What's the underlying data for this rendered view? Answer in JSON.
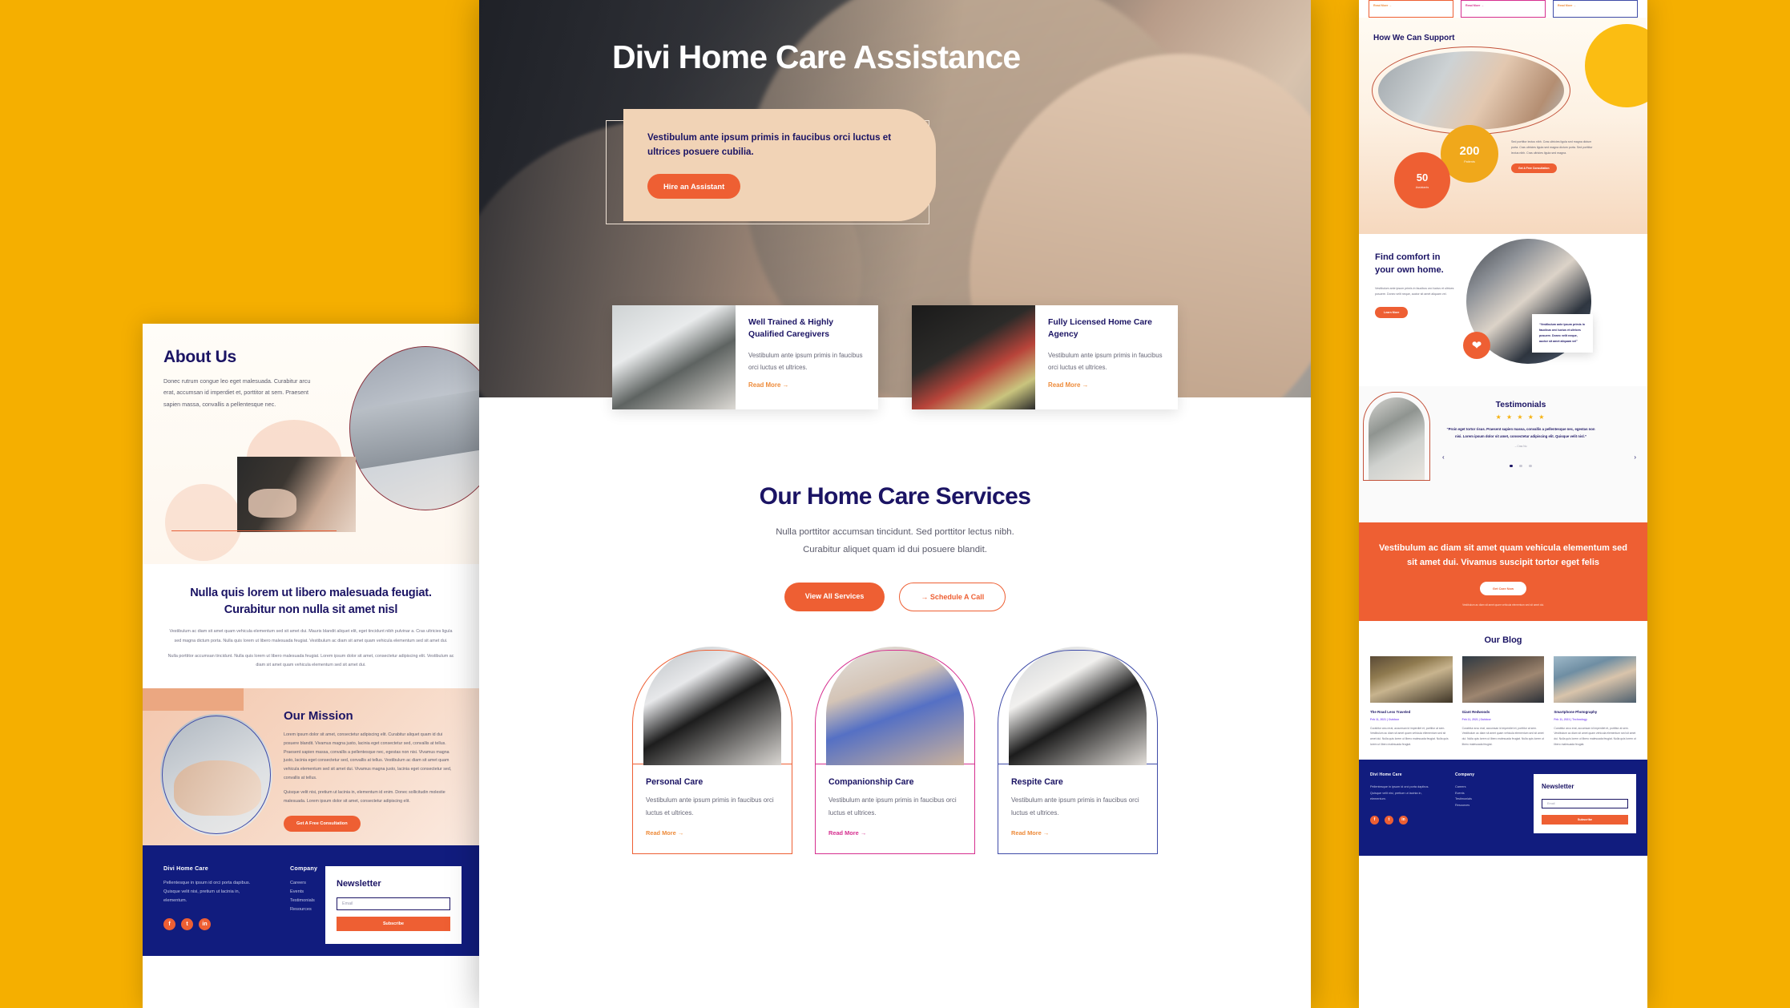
{
  "brand": {
    "accent": "#EE5F33",
    "navy": "#1B1464",
    "yellow": "#F5AF00",
    "footer_bg": "#111C7E"
  },
  "hero": {
    "title": "Divi Home Care Assistance",
    "card_text": "Vestibulum ante ipsum primis in faucibus orci luctus et ultrices posuere cubilia.",
    "cta": "Hire an Assistant"
  },
  "features": [
    {
      "title": "Well Trained & Highly Qualified Caregivers",
      "text": "Vestibulum ante ipsum primis in faucibus orci luctus et ultrices.",
      "link": "Read More  →"
    },
    {
      "title": "Fully Licensed Home Care Agency",
      "text": "Vestibulum ante ipsum primis in faucibus orci luctus et ultrices.",
      "link": "Read More  →"
    }
  ],
  "services": {
    "heading": "Our Home Care Services",
    "sub_line1": "Nulla porttitor accumsan tincidunt. Sed porttitor lectus nibh.",
    "sub_line2": "Curabitur aliquet quam id dui posuere blandit.",
    "btn_primary": "View All Services",
    "btn_secondary": "→  Schedule A Call",
    "cards": [
      {
        "title": "Personal Care",
        "text": "Vestibulum ante ipsum primis in faucibus orci luctus et ultrices.",
        "link": "Read More  →",
        "color": "#EE5F33"
      },
      {
        "title": "Companionship Care",
        "text": "Vestibulum ante ipsum primis in faucibus orci luctus et ultrices.",
        "link": "Read More  →",
        "color": "#D62F8F"
      },
      {
        "title": "Respite Care",
        "text": "Vestibulum ante ipsum primis in faucibus orci luctus et ultrices.",
        "link": "Read More  →",
        "color": "#3E4BA8"
      }
    ]
  },
  "left_page": {
    "about": {
      "heading": "About Us",
      "text": "Donec rutrum congue leo eget malesuada. Curabitur arcu erat, accumsan id imperdiet et, porttitor at sem. Praesent sapien massa, convallis a pellentesque nec."
    },
    "nulla": {
      "heading": "Nulla quis lorem ut libero malesuada feugiat. Curabitur non nulla sit amet nisl",
      "p1": "Vestibulum ac diam sit amet quam vehicula elementum sed sit amet dui. Mauris blandit aliquet elit, eget tincidunt nibh pulvinar a. Cras ultricies ligula sed magna dictum porta. Nulla quis lorem ut libero malesuada feugiat. Vestibulum ac diam sit amet quam vehicula elementum sed sit amet dui.",
      "p2": "Nulla porttitor accumsan tincidunt. Nulla quis lorem ut libero malesuada feugiat. Lorem ipsum dolor sit amet, consectetur adipiscing elit. Vestibulum ac diam sit amet quam vehicula elementum sed sit amet dui."
    },
    "mission": {
      "heading": "Our Mission",
      "p1": "Lorem ipsum dolor sit amet, consectetur adipiscing elit. Curabitur aliquet quam id dui posuere blandit. Vivamus magna justo, lacinia eget consectetur sed, convallis at tellus. Praesent sapien massa, convallis a pellentesque nec, egestas non nisi. Vivamus magna justo, lacinia eget consectetur sed, convallis at tellus. Vestibulum ac diam sit amet quam vehicula elementum sed sit amet dui. Vivamus magna justo, lacinia eget consectetur sed, convallis at tellus.",
      "p2": "Quisque velit nisi, pretium ut lacinia in, elementum id enim. Donec sollicitudin molestie malesuada. Lorem ipsum dolor sit amet, consectetur adipiscing elit.",
      "cta": "Get A Free Consultation"
    }
  },
  "right_page": {
    "top_card_links": [
      "Read More →",
      "Read More →",
      "Read More →"
    ],
    "support": {
      "heading": "How We Can Support",
      "stat_big_value": "200",
      "stat_big_label": "Patients",
      "stat_small_value": "50",
      "stat_small_label": "Assistants",
      "text": "Sed porttitor lectus nibh. Cras ultricies ligula sed magna dictum porta. Cras ultricies ligula sed magna dictum porta. Sed porttitor lectus nibh. Cras ultricies ligula sed magna.",
      "cta": "Get A Free Consultation"
    },
    "comfort": {
      "heading": "Find comfort in your own home.",
      "text": "Vestibulum ante ipsum primis in faucibus orci luctus et ultrices posuere. Donec velit neque, auctor sit amet aliquam vel.",
      "cta": "Learn More",
      "quote": "“Vestibulum ante ipsum primis in faucibus orci luctus et ultrices posuere. Donec velit neque, auctor sit amet aliquam vel”"
    },
    "testimonials": {
      "heading": "Testimonials",
      "stars": "★ ★ ★ ★ ★",
      "quote": "“Proin eget tortor risus. Praesent sapien massa, convallis a pellentesque nec, egestas non nisi. Lorem ipsum dolor sit amet, consectetur adipiscing elit. Quisque velit nisl.”",
      "author": "– Cras Nu",
      "prev": "‹",
      "next": "›"
    },
    "cta": {
      "heading": "Vestibulum ac diam sit amet quam vehicula elementum sed sit amet dui. Vivamus suscipit tortor eget felis",
      "button": "Get Care Now",
      "fine": "Vestibulum ac diam sit amet quam vehicula elementum sed sit amet dui."
    },
    "blog": {
      "heading": "Our Blog",
      "posts": [
        {
          "title": "The Road Less Traveled",
          "meta": "Feb 11, 2021 | Outdoor",
          "text": "Curabitur arcu erat, accumsan id imperdiet et, porttitor at sem. Vestibulum ac diam sit amet quam vehicula ellementum sed sit amet dui. Nulla quis lorem ut libero malesuada feugiat. Nulla quis lorem ut libero malesuada feugiat."
        },
        {
          "title": "Giant Redwoods",
          "meta": "Feb 11, 2021 | Outdoor",
          "text": "Curabitur arcu erat, accumsan id imperdiet et, porttitor at sem. Vestibulum ac diam sit amet quam vehicula elementum sed sit amet dui. Nulla quis lorem ut libero malesuada feugiat. Nulla quis lorem ut libero malesuada feugiat."
        },
        {
          "title": "Smartphone Photography",
          "meta": "Feb 11, 2021 | Technology",
          "text": "Curabitur arcu erat, accumsan id imperdiet et, porttitor at sem. Vestibulum ac diam sit amet quam vehicula elementum sed sit amet dui. Nulla quis lorem ut libero malesuada feugiat. Nulla quis lorem ut libero malesuada feugiat."
        }
      ]
    }
  },
  "footer": {
    "brand_title": "Divi Home Care",
    "brand_text": "Pellentesque in ipsum id orci porta dapibus. Quisque velit nisi, pretium ut lacinia in, elementum.",
    "company_title": "Company",
    "company_links": [
      "Careers",
      "Events",
      "Testimonials",
      "Resources"
    ],
    "social": [
      "f",
      "t",
      "in"
    ],
    "newsletter_title": "Newsletter",
    "email_placeholder": "Email",
    "subscribe": "Subscribe"
  }
}
